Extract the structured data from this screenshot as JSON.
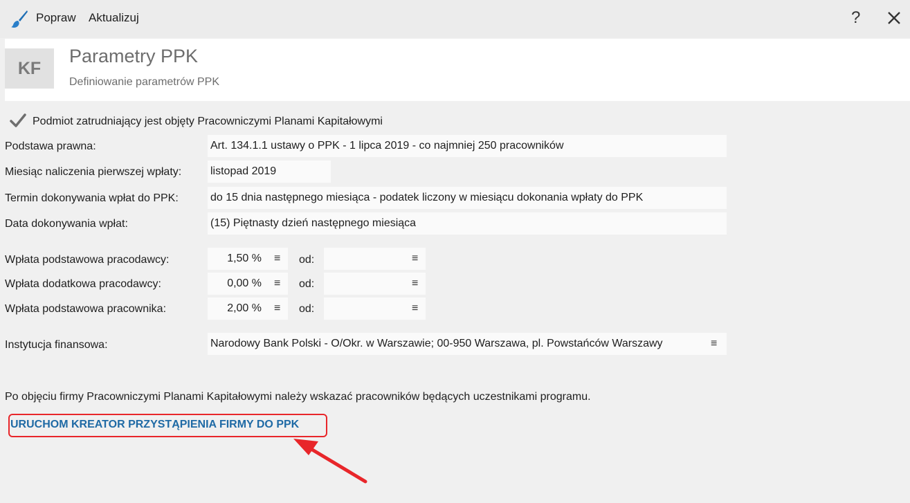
{
  "toolbar": {
    "fix_label": "Popraw",
    "update_label": "Aktualizuj",
    "help_label": "?",
    "icons": {
      "brush": "paintbrush-icon",
      "close": "close-icon"
    }
  },
  "header": {
    "badge": "KF",
    "title": "Parametry PPK",
    "subtitle": "Definiowanie parametrów PPK"
  },
  "form": {
    "covered_checkbox": {
      "checked": true,
      "label": "Podmiot zatrudniający jest objęty Pracowniczymi Planami Kapitałowymi"
    },
    "legal_basis": {
      "label": "Podstawa prawna:",
      "value": "Art. 134.1.1 ustawy o PPK - 1 lipca 2019 - co najmniej 250 pracowników"
    },
    "first_payment_month": {
      "label": "Miesiąc naliczenia pierwszej wpłaty:",
      "value": "listopad 2019"
    },
    "payment_deadline": {
      "label": "Termin dokonywania wpłat do PPK:",
      "value": "do 15 dnia następnego miesiąca - podatek liczony w miesiącu dokonania wpłaty do PPK"
    },
    "payment_date": {
      "label": "Data dokonywania wpłat:",
      "value": "(15) Piętnasty dzień następnego miesiąca"
    },
    "contributions": [
      {
        "label": "Wpłata podstawowa pracodawcy:",
        "value": "1,50 %",
        "od_label": "od:",
        "od_value": ""
      },
      {
        "label": "Wpłata dodatkowa pracodawcy:",
        "value": "0,00 %",
        "od_label": "od:",
        "od_value": ""
      },
      {
        "label": "Wpłata podstawowa pracownika:",
        "value": "2,00 %",
        "od_label": "od:",
        "od_value": ""
      }
    ],
    "financial_institution": {
      "label": "Instytucja finansowa:",
      "value": "Narodowy Bank Polski  - O/Okr. w Warszawie; 00-950 Warszawa, pl. Powstańców Warszawy"
    }
  },
  "info_text": "Po objęciu firmy Pracowniczymi Planami Kapitałowymi należy wskazać pracowników będących uczestnikami programu.",
  "wizard_link": "URUCHOM KREATOR PRZYSTĄPIENIA FIRMY DO PPK",
  "menu_glyph": "≡",
  "colors": {
    "link": "#1f6aa5",
    "highlight": "#e8262a",
    "background": "#f0f0f0"
  }
}
